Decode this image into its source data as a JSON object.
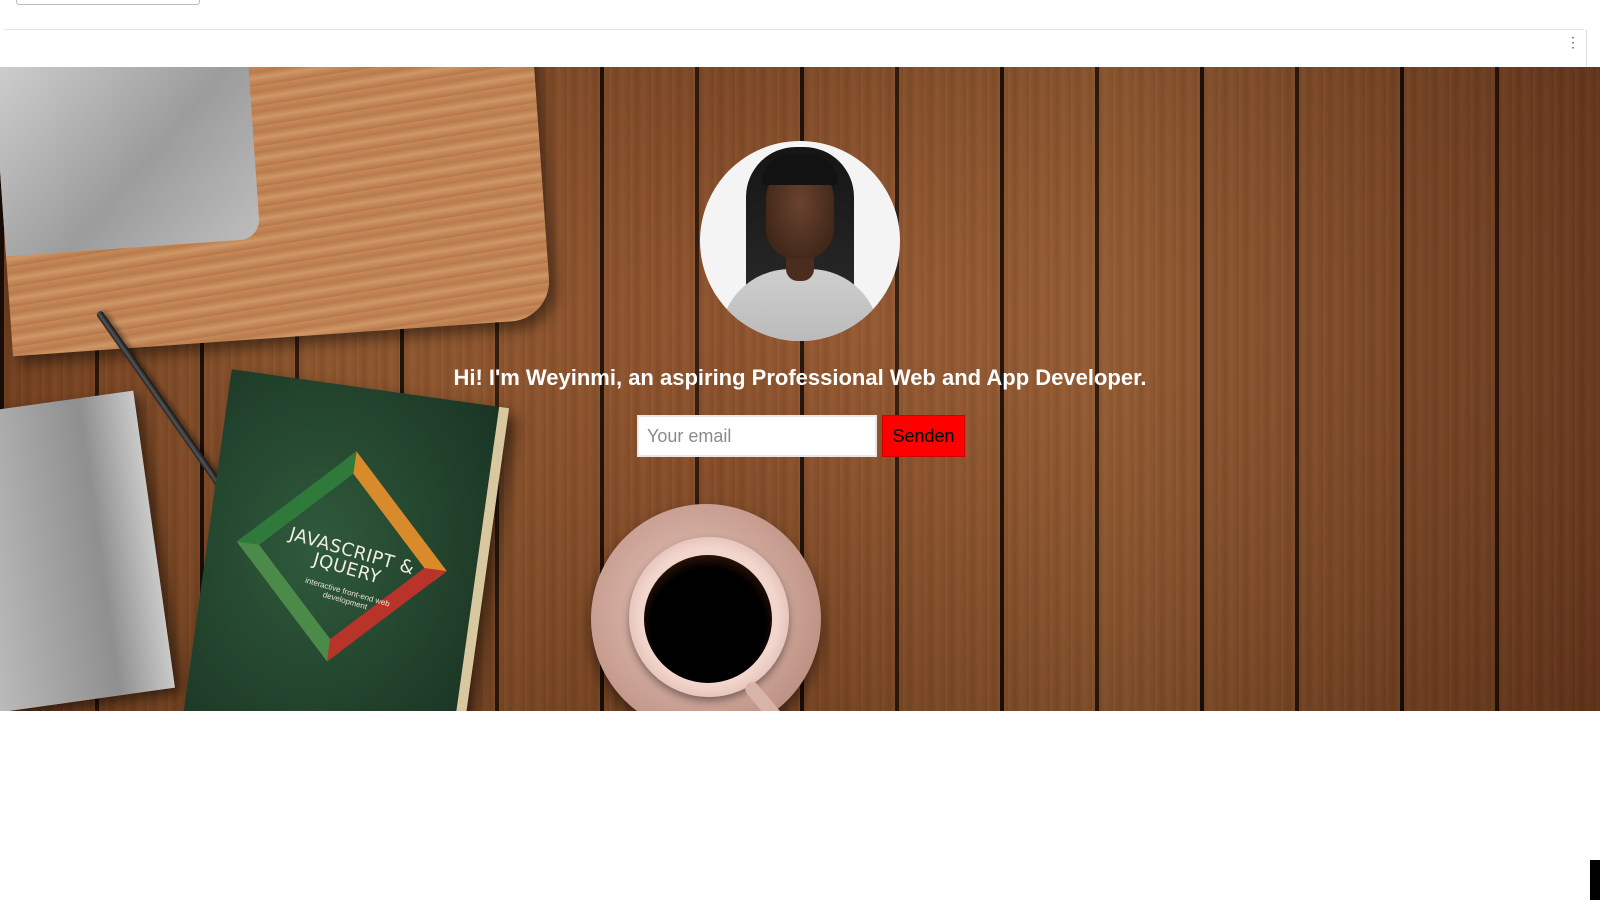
{
  "browser": {
    "menu_icon": "vertical-dots-icon"
  },
  "hero": {
    "book_title": "JAVASCRIPT & JQUERY",
    "book_subtitle": "interactive front-end web development",
    "tagline": "Hi! I'm Weyinmi, an aspiring Professional Web and App Developer."
  },
  "signup": {
    "email_placeholder": "Your email",
    "email_value": "",
    "send_label": "Senden",
    "send_color": "#ff0000"
  }
}
